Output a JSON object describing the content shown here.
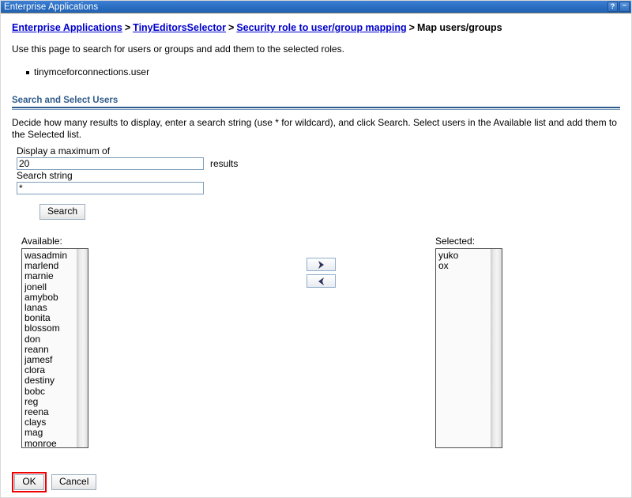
{
  "window": {
    "title": "Enterprise Applications",
    "help_button": "?",
    "minimize_button": "–"
  },
  "breadcrumb": {
    "items": [
      {
        "label": "Enterprise Applications",
        "link": true
      },
      {
        "label": "TinyEditorsSelector",
        "link": true
      },
      {
        "label": "Security role to user/group mapping",
        "link": true
      },
      {
        "label": "Map users/groups",
        "link": false
      }
    ],
    "separator": ">"
  },
  "intro": "Use this page to search for users or groups and add them to the selected roles.",
  "roles": [
    "tinymceforconnections.user"
  ],
  "section": {
    "header": "Search and Select Users",
    "description": "Decide how many results to display, enter a search string (use * for wildcard), and click Search. Select users in the Available list and add them to the Selected list."
  },
  "form": {
    "max_label": "Display a maximum of",
    "max_value": "20",
    "results_label": "results",
    "search_label": "Search string",
    "search_value": "*",
    "search_button": "Search"
  },
  "transfer": {
    "available_label": "Available:",
    "available_items": [
      "wasadmin",
      "marlend",
      "marnie",
      "jonell",
      "amybob",
      "lanas",
      "bonita",
      "blossom",
      "don",
      "reann",
      "jamesf",
      "clora",
      "destiny",
      "bobc",
      "reg",
      "reena",
      "clays",
      "mag",
      "monroe"
    ],
    "selected_label": "Selected:",
    "selected_items": [
      "yuko",
      "ox"
    ],
    "add_button_title": "Add",
    "remove_button_title": "Remove"
  },
  "footer": {
    "ok_label": "OK",
    "cancel_label": "Cancel"
  },
  "colors": {
    "titlebar_blue": "#2a6ec2",
    "link_blue": "#0000cc",
    "section_blue": "#2e5b8a",
    "highlight_red": "#ee0000",
    "arrow_navy": "#2e3356"
  }
}
